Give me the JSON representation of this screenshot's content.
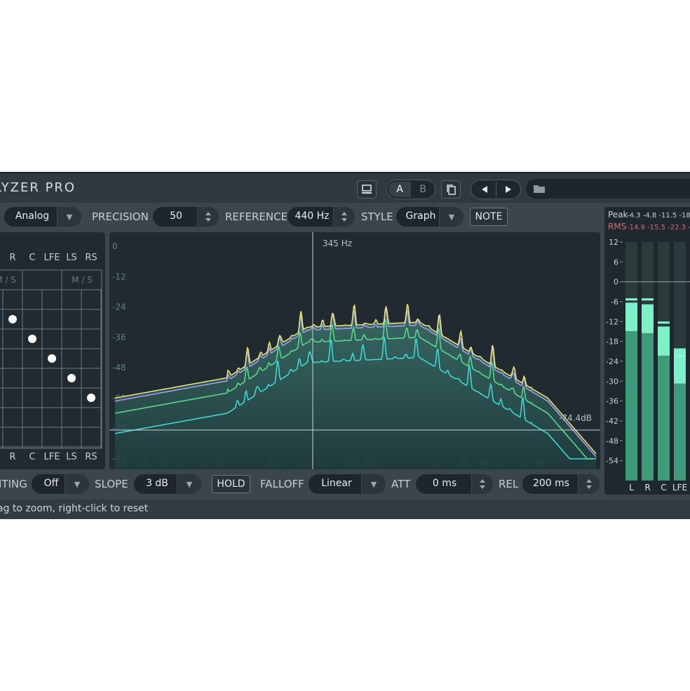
{
  "app": {
    "title": "LYZER PRO"
  },
  "toolbar": {
    "ab_a": "A",
    "ab_b": "B"
  },
  "controls": {
    "mode_value": "Analog",
    "precision_label": "PRECISION",
    "precision_value": "50",
    "reference_label": "REFERENCE",
    "reference_value": "440 Hz",
    "style_label": "STYLE",
    "style_value": "Graph",
    "note_button": "NOTE"
  },
  "matrix": {
    "top_labels": [
      "R",
      "C",
      "LFE",
      "LS",
      "RS"
    ],
    "bottom_labels": [
      "R",
      "C",
      "LFE",
      "LS",
      "RS"
    ],
    "ms_left": "M / S",
    "ms_right": "M / S"
  },
  "graph": {
    "cursor_label": "345 Hz",
    "level_label": "-74.4dB",
    "y_ticks": [
      "0",
      "-12",
      "-24",
      "-36",
      "-48",
      "-60",
      "-72",
      "-84"
    ],
    "x_ticks": [
      "20",
      "30",
      "40",
      "50",
      "70",
      "90",
      "200",
      "300",
      "400",
      "600",
      "800",
      "2k",
      "3k",
      "4k",
      "5k",
      "7k",
      "9k",
      "20k"
    ],
    "colors": {
      "yellow": "#e8e27a",
      "violet": "#a99be6",
      "green": "#5ad88e",
      "cyan": "#3fd8d2"
    }
  },
  "meters": {
    "peak_label": "Peak",
    "peak_values": "-4.3  -4.8  -11.5 -18.1",
    "rms_label": "RMS",
    "rms_values": "-14.9 -15.5 -22.3 -30.7",
    "scale": [
      "12",
      "6",
      "0",
      "-6",
      "-12",
      "-18",
      "-24",
      "-30",
      "-36",
      "-42",
      "-48",
      "-54"
    ],
    "channels": [
      "L",
      "R",
      "C",
      "LFE"
    ],
    "peak_db": [
      -4.3,
      -4.8,
      -11.5,
      -18.1
    ],
    "rms_db": [
      -14.9,
      -15.5,
      -22.3,
      -30.7
    ],
    "hold_db": [
      -8,
      -8,
      -15,
      -25
    ]
  },
  "bottom": {
    "weighting_label": "ITING",
    "weighting_value": "Off",
    "slope_label": "SLOPE",
    "slope_value": "3 dB",
    "hold_button": "HOLD",
    "falloff_label": "FALLOFF",
    "falloff_value": "Linear",
    "att_label": "ATT",
    "att_value": "0 ms",
    "rel_label": "REL",
    "rel_value": "200 ms"
  },
  "status": {
    "text": "ag to zoom, right-click to reset"
  }
}
